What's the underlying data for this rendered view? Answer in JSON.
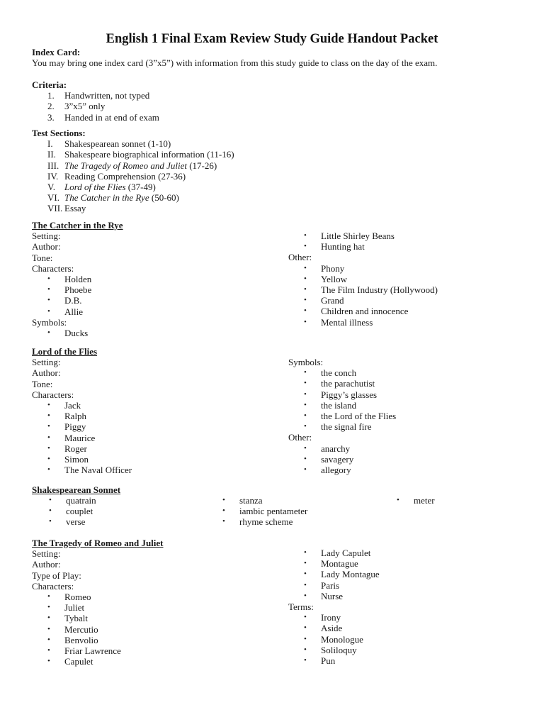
{
  "title": "English 1 Final Exam Review Study Guide Handout Packet",
  "index_card": {
    "heading": "Index Card:",
    "text": "You may bring one index card (3”x5”) with information from this study guide to class on the day of the exam."
  },
  "criteria": {
    "heading": "Criteria:",
    "items": [
      {
        "num": "1.",
        "text": "Handwritten, not typed"
      },
      {
        "num": "2.",
        "text": "3”x5” only"
      },
      {
        "num": "3.",
        "text": "Handed in at end of exam"
      }
    ]
  },
  "test_sections": {
    "heading": "Test Sections:",
    "items": [
      {
        "num": "I.",
        "title": "",
        "text": "Shakespearean sonnet (1-10)"
      },
      {
        "num": "II.",
        "title": "",
        "text": "Shakespeare biographical information (11-16)"
      },
      {
        "num": "III.",
        "title": "The Tragedy of Romeo and Juliet",
        "text": " (17-26)"
      },
      {
        "num": "IV.",
        "title": "",
        "text": "Reading Comprehension (27-36)"
      },
      {
        "num": "V.",
        "title": "Lord of the Flies",
        "text": " (37-49)"
      },
      {
        "num": "VI.",
        "title": "The Catcher in the Rye",
        "text": " (50-60)"
      },
      {
        "num": "VII.",
        "title": "",
        "text": "Essay"
      }
    ]
  },
  "catcher": {
    "heading": "The Catcher in the Rye",
    "setting": "Setting:",
    "author": "Author:",
    "tone": "Tone:",
    "characters_label": "Characters:",
    "characters": [
      "Holden",
      "Phoebe",
      "D.B.",
      "Allie"
    ],
    "symbols_label": "Symbols:",
    "symbols": [
      "Ducks",
      "Little Shirley Beans",
      "Hunting hat"
    ],
    "other_label": "Other:",
    "other": [
      "Phony",
      "Yellow",
      "The Film Industry (Hollywood)",
      "Grand",
      "Children and innocence",
      "Mental illness"
    ]
  },
  "lotf": {
    "heading": "Lord of the Flies",
    "setting": "Setting:",
    "author": "Author:",
    "tone": "Tone:",
    "characters_label": "Characters:",
    "characters": [
      "Jack",
      "Ralph",
      "Piggy",
      "Maurice",
      "Roger",
      "Simon",
      "The Naval Officer"
    ],
    "symbols_label": "Symbols:",
    "symbols": [
      "the conch",
      "the parachutist",
      "Piggy’s glasses",
      "the island",
      "the Lord of the Flies",
      "the signal fire"
    ],
    "other_label": "Other:",
    "other": [
      "anarchy",
      "savagery",
      "allegory"
    ]
  },
  "sonnet": {
    "heading": "Shakespearean Sonnet",
    "col1": [
      "quatrain",
      "couplet",
      "verse"
    ],
    "col2": [
      "stanza",
      "iambic pentameter",
      "rhyme scheme"
    ],
    "col3": [
      "meter"
    ]
  },
  "romeo": {
    "heading": "The Tragedy of Romeo and Juliet",
    "setting": "Setting:",
    "author": "Author:",
    "type": "Type of Play:",
    "characters_label": "Characters:",
    "characters": [
      "Romeo",
      "Juliet",
      "Tybalt",
      "Mercutio",
      "Benvolio",
      "Friar Lawrence",
      "Capulet",
      "Lady Capulet",
      "Montague",
      "Lady Montague",
      "Paris",
      "Nurse"
    ],
    "terms_label": "Terms:",
    "terms": [
      "Irony",
      "Aside",
      "Monologue",
      "Soliloquy",
      "Pun"
    ]
  },
  "bullet": "•"
}
